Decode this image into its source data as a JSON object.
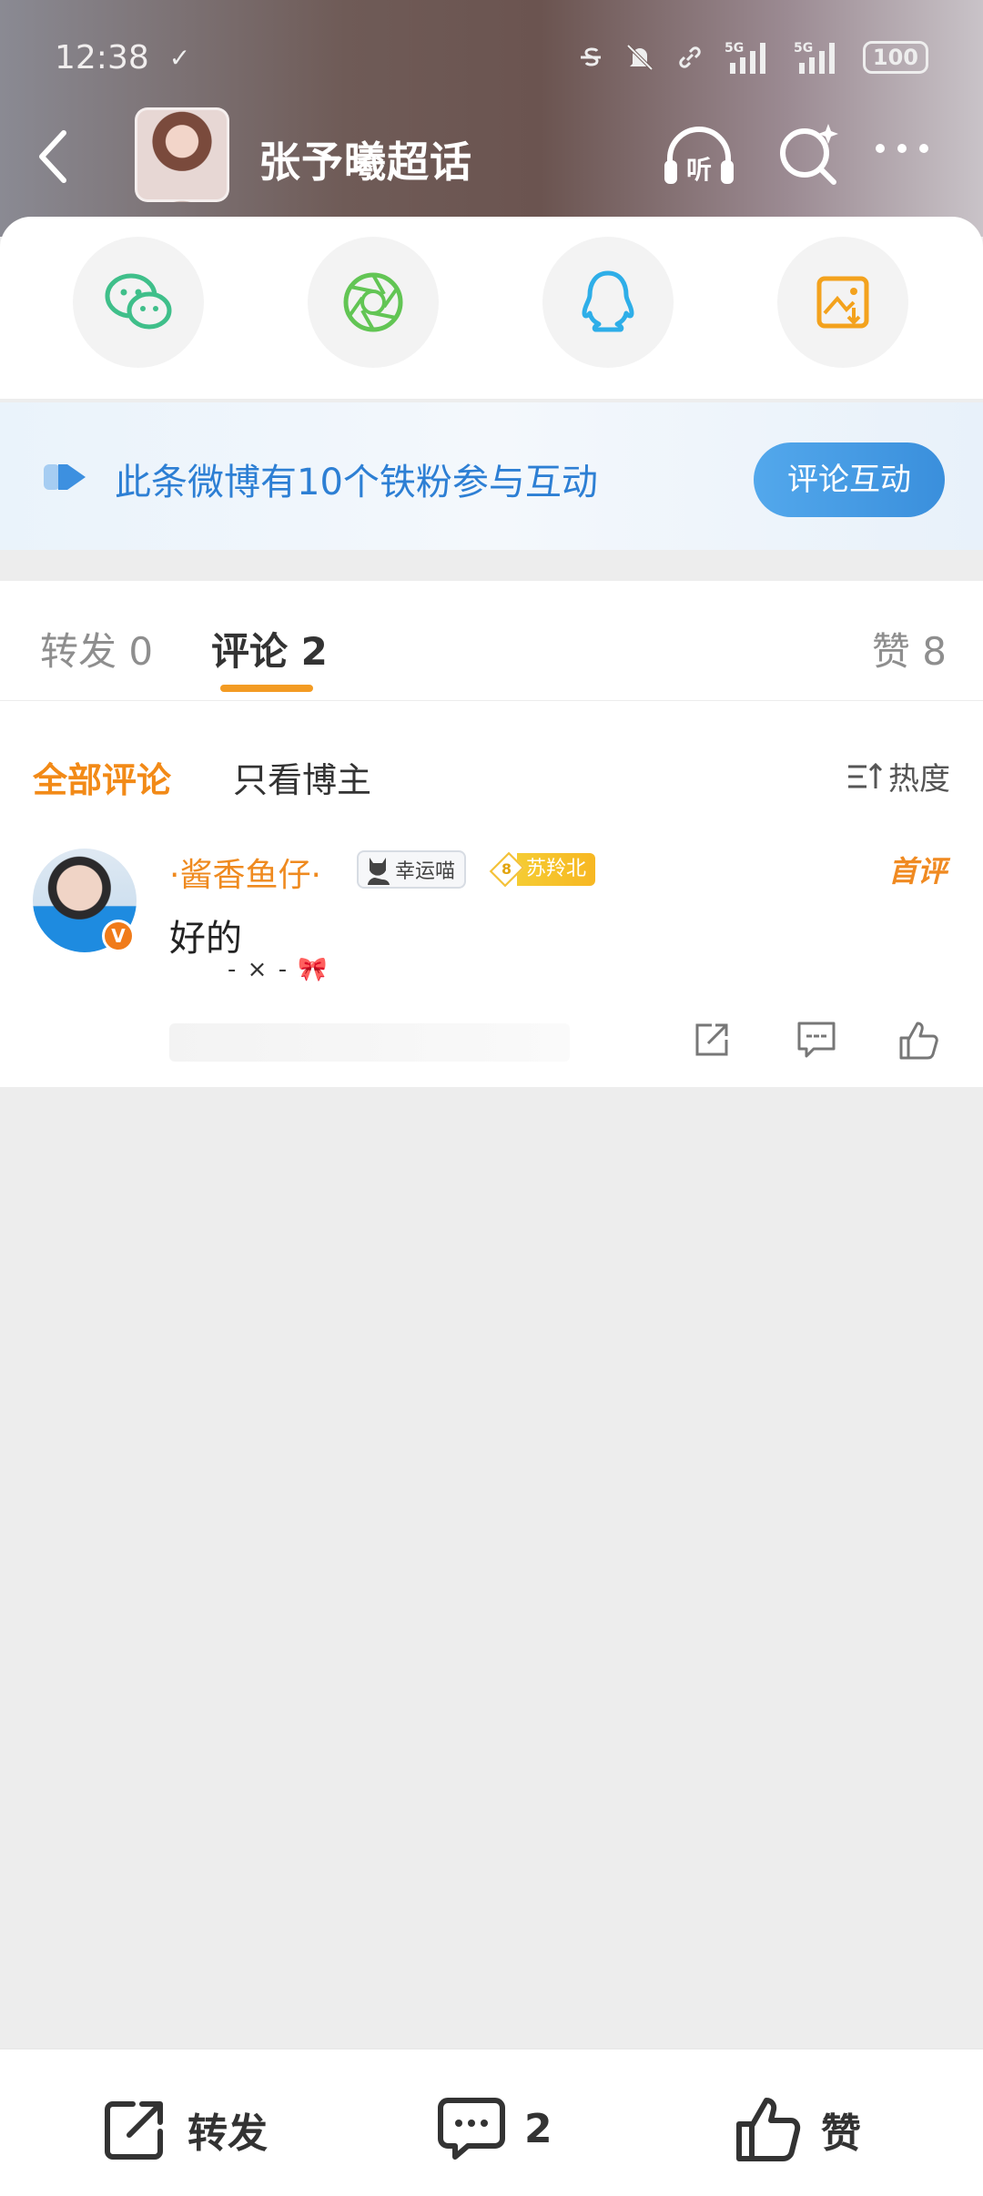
{
  "status_bar": {
    "time": "12:38",
    "battery": "100",
    "network": "5G"
  },
  "header": {
    "title": "张予曦超话",
    "listen_label": "听"
  },
  "share_sheet": {
    "items": [
      "wechat-icon",
      "moments-icon",
      "qq-icon",
      "save-image-icon"
    ]
  },
  "banner": {
    "text": "此条微博有10个铁粉参与互动",
    "button": "评论互动"
  },
  "tabs": {
    "repost": "转发 0",
    "comments": "评论 2",
    "likes": "赞 8"
  },
  "filter": {
    "all": "全部评论",
    "owner_only": "只看博主",
    "sort": "热度"
  },
  "comment": {
    "username": "·酱香鱼仔·",
    "badge_lucky": "幸运喵",
    "fan_level": "8",
    "fan_group": "苏羚北",
    "first_badge": "首评",
    "verified_mark": "V",
    "text": "好的"
  },
  "bottom_bar": {
    "repost": "转发",
    "comment_count": "2",
    "like": "赞"
  },
  "colors": {
    "accent_orange": "#f28a17",
    "link_blue": "#2d7fd4"
  }
}
